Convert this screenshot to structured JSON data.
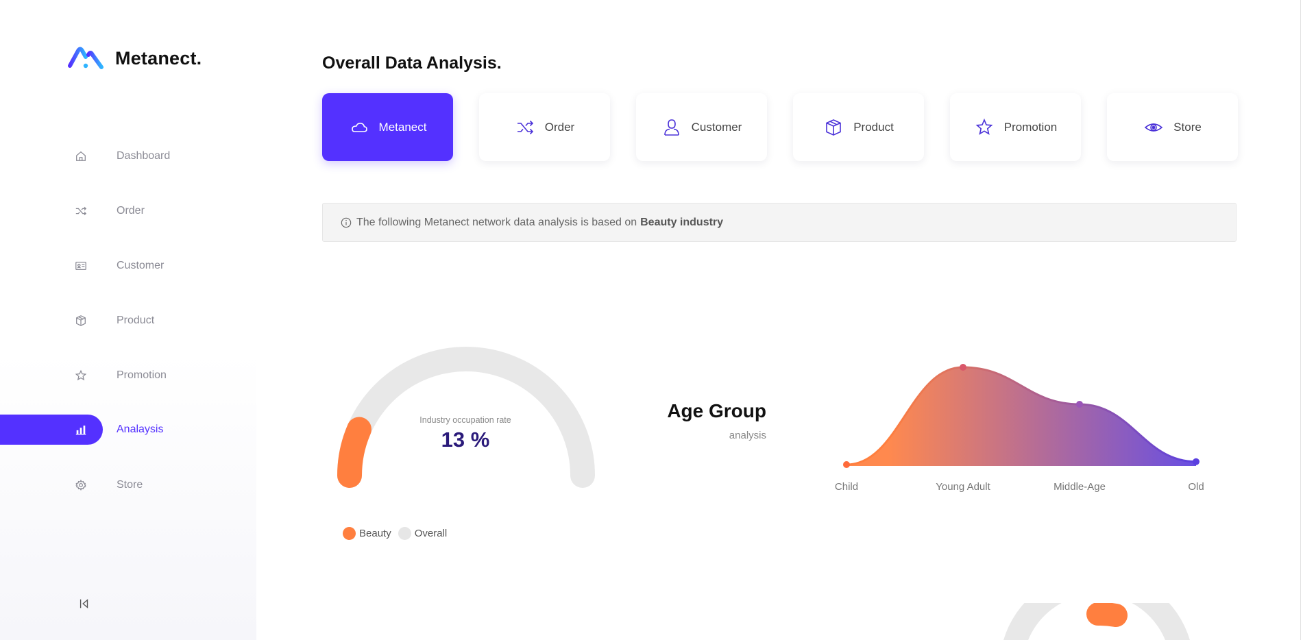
{
  "brand": {
    "name": "Metanect.",
    "accent": "#5431ff"
  },
  "sidebar": {
    "items": [
      {
        "label": "Dashboard",
        "icon": "home-icon"
      },
      {
        "label": "Order",
        "icon": "shuffle-icon"
      },
      {
        "label": "Customer",
        "icon": "id-card-icon"
      },
      {
        "label": "Product",
        "icon": "box-icon"
      },
      {
        "label": "Promotion",
        "icon": "star-icon"
      },
      {
        "label": "Analaysis",
        "icon": "bar-chart-icon",
        "active": true
      },
      {
        "label": "Store",
        "icon": "gear-icon"
      }
    ],
    "collapse_icon": "collapse-left-icon"
  },
  "main": {
    "title": "Overall Data Analysis.",
    "tabs": [
      {
        "label": "Metanect",
        "icon": "cloud-icon",
        "active": true
      },
      {
        "label": "Order",
        "icon": "shuffle-icon"
      },
      {
        "label": "Customer",
        "icon": "user-icon"
      },
      {
        "label": "Product",
        "icon": "box-icon"
      },
      {
        "label": "Promotion",
        "icon": "star-icon"
      },
      {
        "label": "Store",
        "icon": "eye-icon"
      }
    ],
    "notice": {
      "text": "The following Metanect network data analysis is based on",
      "emphasis": "Beauty industry",
      "icon": "info-icon"
    },
    "gauge": {
      "caption": "Industry occupation rate",
      "value_text": "13 %",
      "value": 13,
      "colors": {
        "beauty": "#ff7f3f",
        "overall": "#e8e8e8"
      },
      "legend": [
        {
          "label": "Beauty",
          "color": "#ff7f3f"
        },
        {
          "label": "Overall",
          "color": "#e8e8e8"
        }
      ]
    },
    "age_group": {
      "title": "Age Group",
      "subtitle": "analysis"
    }
  },
  "chart_data": {
    "type": "area",
    "categories": [
      "Child",
      "Young Adult",
      "Middle-Age",
      "Old"
    ],
    "values": [
      0,
      100,
      62,
      3
    ],
    "ylim": [
      0,
      100
    ],
    "grid": false,
    "colors": {
      "start": "#ff7f3f",
      "end": "#5a3fe0"
    }
  }
}
